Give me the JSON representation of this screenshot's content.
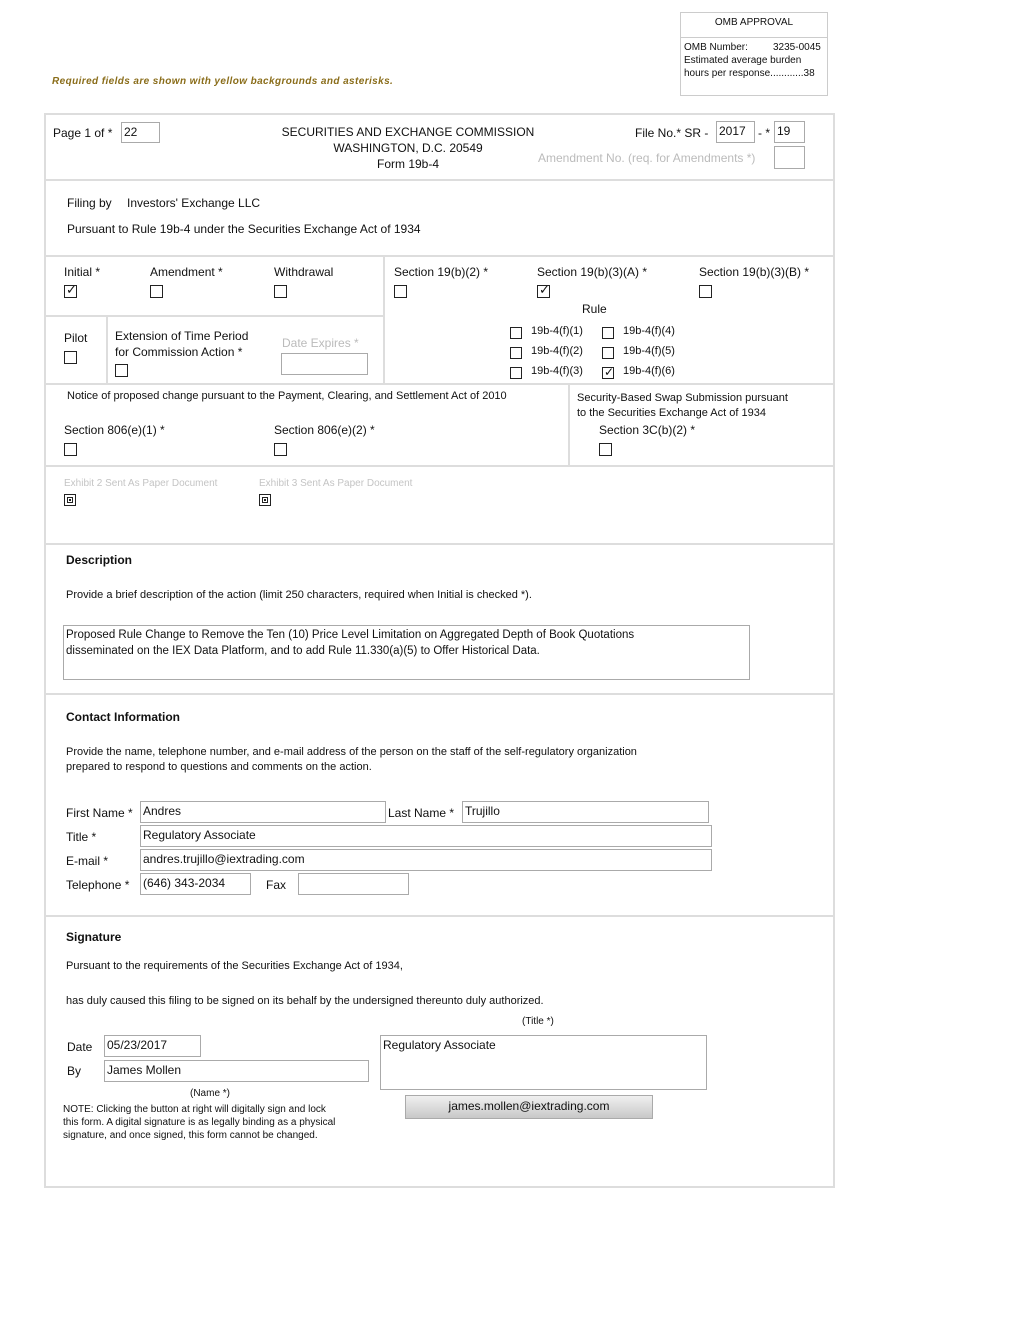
{
  "omb": {
    "title": "OMB APPROVAL",
    "number_label": "OMB Number:",
    "number_value": "3235-0045",
    "burden_line1": "Estimated average burden",
    "burden_line2": "hours per response............38"
  },
  "required_note": "Required fields are shown with yellow backgrounds and asterisks.",
  "header": {
    "page_label": "Page 1 of *",
    "page_total": "22",
    "agency_line1": "SECURITIES AND EXCHANGE COMMISSION",
    "agency_line2": "WASHINGTON, D.C.  20549",
    "form_name": "Form 19b-4",
    "file_no_label": "File No.* SR -",
    "file_year": "2017",
    "file_sep": "- *",
    "file_number": "19",
    "amendment_label": "Amendment No. (req. for Amendments *)",
    "amendment_value": ""
  },
  "filing": {
    "filing_by_label": "Filing by",
    "filer": "Investors' Exchange LLC",
    "pursuant": "Pursuant to Rule 19b-4 under the Securities Exchange Act of 1934"
  },
  "filing_type": {
    "initial": {
      "label": "Initial *",
      "checked": true
    },
    "amendment": {
      "label": "Amendment *",
      "checked": false
    },
    "withdrawal": {
      "label": "Withdrawal",
      "checked": false
    },
    "pilot": {
      "label": "Pilot",
      "checked": false
    },
    "extension_line1": "Extension of Time Period",
    "extension_line2": "for Commission Action *",
    "extension_checked": false,
    "date_expires_label": "Date Expires *",
    "date_expires_value": ""
  },
  "sections": {
    "s19b2": {
      "label": "Section 19(b)(2) *",
      "checked": false
    },
    "s19b3a": {
      "label": "Section 19(b)(3)(A) *",
      "checked": true
    },
    "s19b3b": {
      "label": "Section 19(b)(3)(B) *",
      "checked": false
    },
    "rule_label": "Rule",
    "rules": [
      {
        "label": "19b-4(f)(1)",
        "checked": false
      },
      {
        "label": "19b-4(f)(2)",
        "checked": false
      },
      {
        "label": "19b-4(f)(3)",
        "checked": false
      },
      {
        "label": "19b-4(f)(4)",
        "checked": false
      },
      {
        "label": "19b-4(f)(5)",
        "checked": false
      },
      {
        "label": "19b-4(f)(6)",
        "checked": true
      }
    ]
  },
  "pcs": {
    "notice": "Notice of proposed change pursuant to the Payment, Clearing, and Settlement Act of 2010",
    "s806e1": "Section 806(e)(1) *",
    "s806e2": "Section 806(e)(2) *",
    "swap_line1": "Security-Based Swap Submission pursuant",
    "swap_line2": "to the Securities Exchange Act of 1934",
    "s3cb2": "Section 3C(b)(2) *"
  },
  "exhibits": {
    "exhibit2": "Exhibit 2 Sent As Paper Document",
    "exhibit3": "Exhibit 3 Sent As Paper Document"
  },
  "description": {
    "heading": "Description",
    "instructions": "Provide a brief description of the action (limit 250 characters, required when Initial is checked *).",
    "line1": "Proposed Rule Change to Remove the Ten (10) Price Level Limitation on Aggregated Depth of Book Quotations",
    "line2": "disseminated on the IEX Data Platform, and to add Rule 11.330(a)(5) to Offer Historical Data."
  },
  "contact": {
    "heading": "Contact Information",
    "instr_line1": "Provide the name, telephone number, and e-mail address of the person on the staff of the self-regulatory organization",
    "instr_line2": "prepared to respond to questions and comments on the action.",
    "first_name_label": "First Name *",
    "first_name": "Andres",
    "last_name_label": "Last Name *",
    "last_name": "Trujillo",
    "title_label": "Title *",
    "title": "Regulatory Associate",
    "email_label": "E-mail *",
    "email": "andres.trujillo@iextrading.com",
    "phone_label": "Telephone *",
    "phone": "(646) 343-2034",
    "fax_label": "Fax",
    "fax": ""
  },
  "signature": {
    "heading": "Signature",
    "line1": "Pursuant to the requirements of the Securities Exchange Act of 1934,",
    "line2": "has duly caused this filing to be signed on its behalf by the undersigned thereunto duly authorized.",
    "title_caption": "(Title *)",
    "date_label": "Date",
    "date": "05/23/2017",
    "by_label": "By",
    "by": "James Mollen",
    "name_caption": "(Name *)",
    "title_value": "Regulatory Associate",
    "note_line1": "NOTE: Clicking the button at right will digitally sign and lock",
    "note_line2": "this form.  A digital signature is as legally binding as a physical",
    "note_line3": "signature, and once signed, this form cannot be changed.",
    "sign_button": "james.mollen@iextrading.com"
  }
}
